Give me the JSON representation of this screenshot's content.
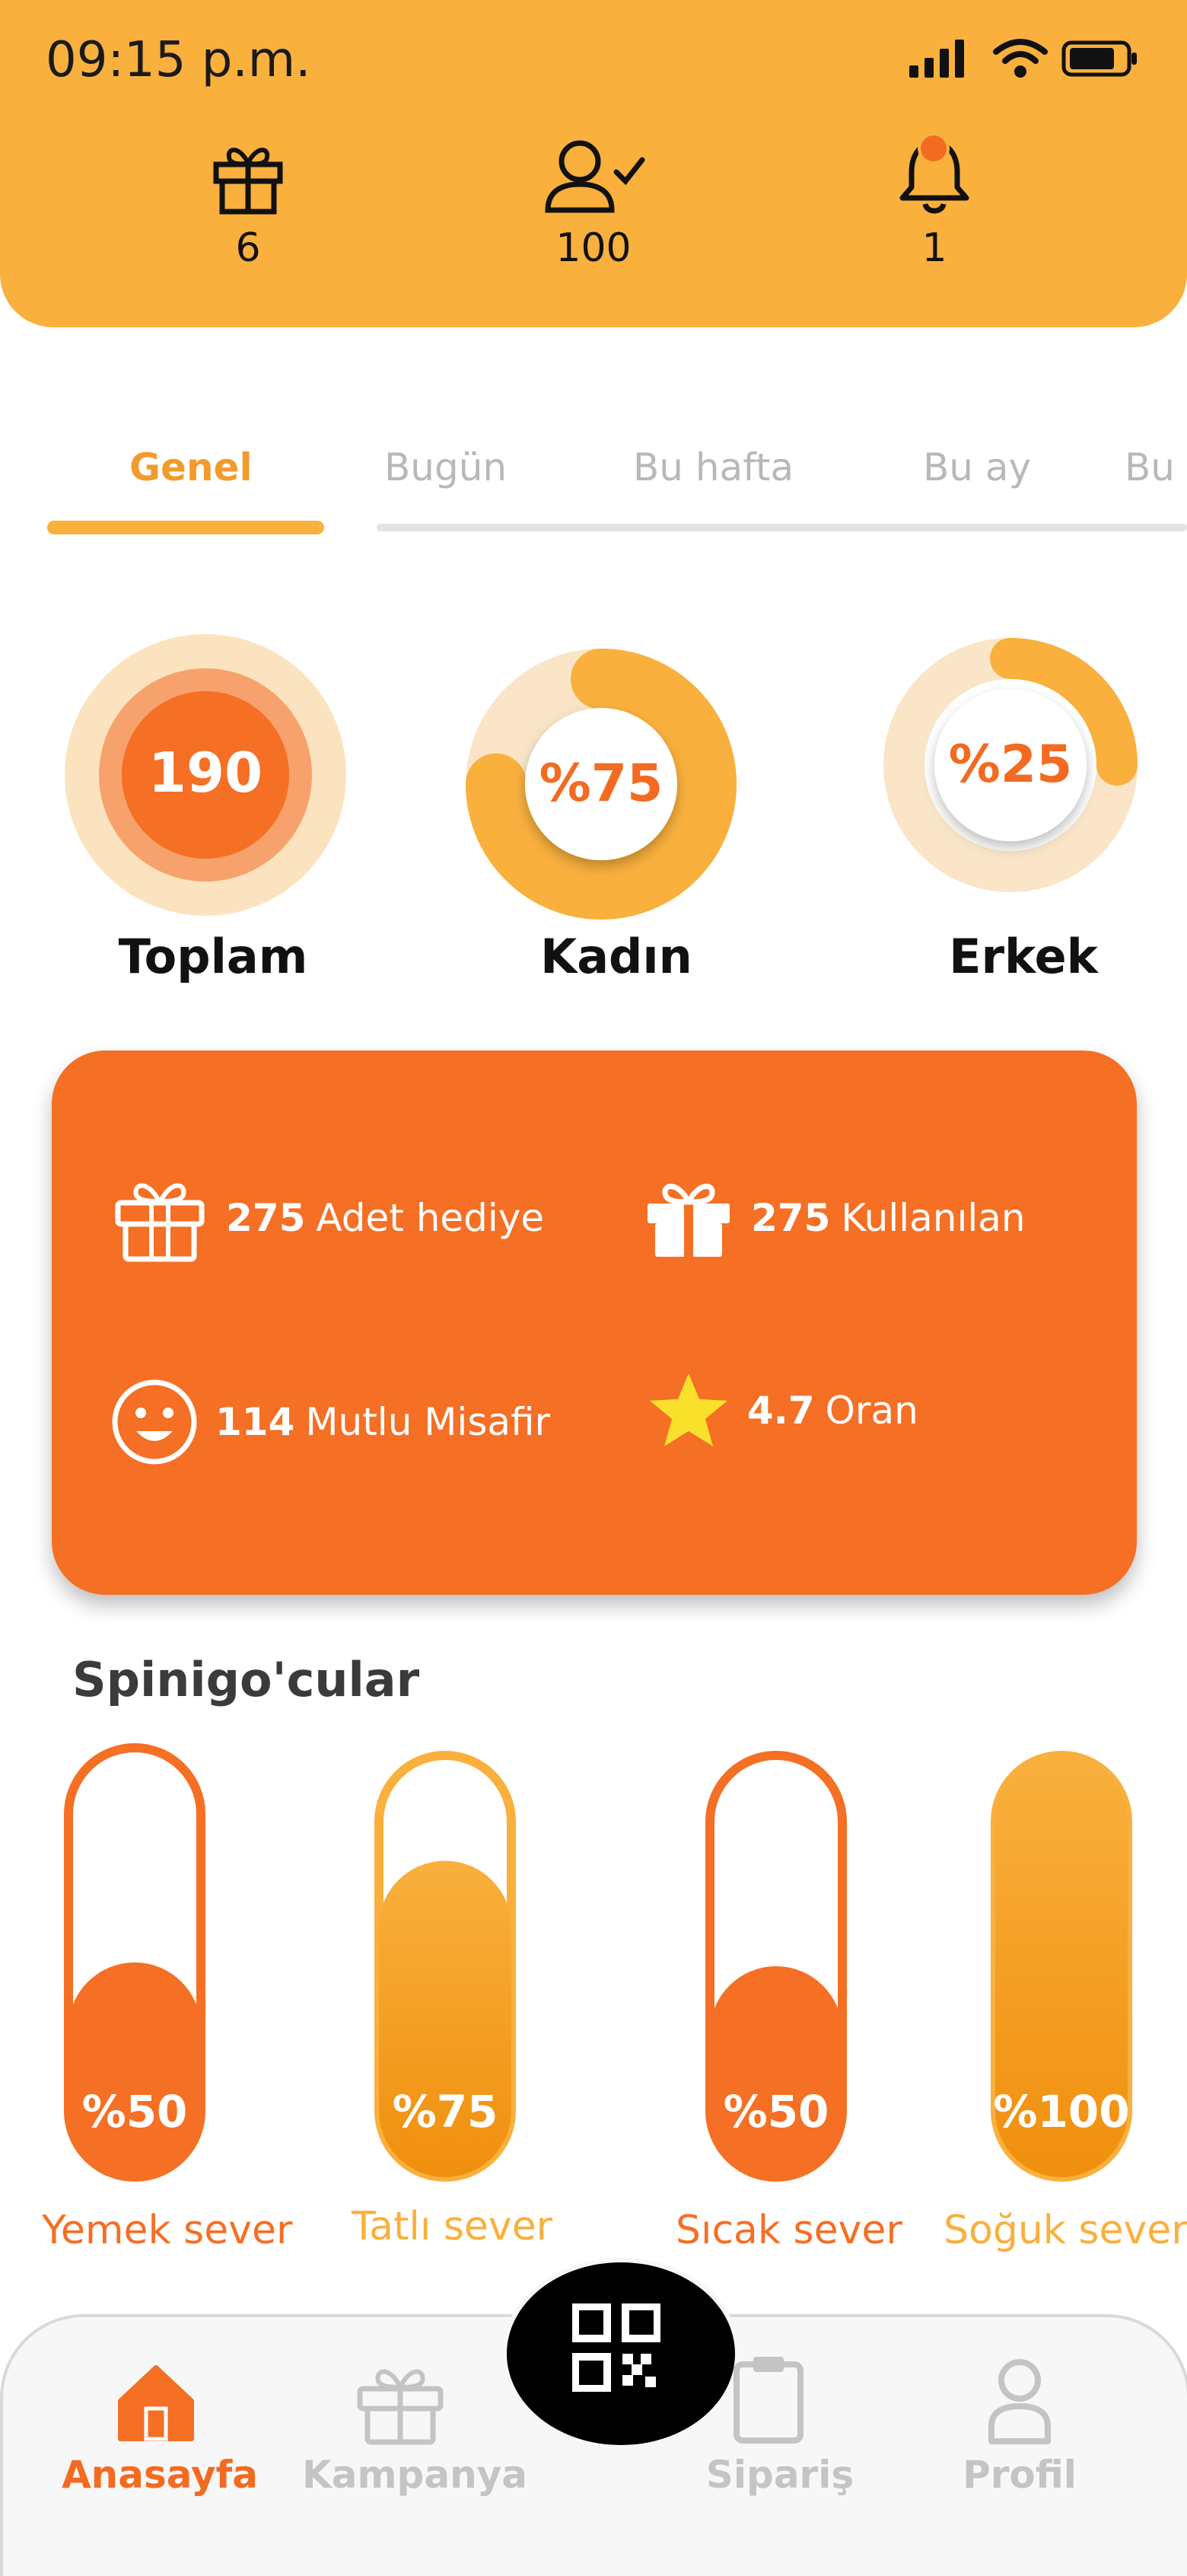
{
  "status_bar": {
    "time": "09:15 p.m."
  },
  "header": {
    "stats": [
      {
        "icon": "gift-icon",
        "value": "6"
      },
      {
        "icon": "user-check-icon",
        "value": "100"
      },
      {
        "icon": "bell-icon",
        "value": "1"
      }
    ]
  },
  "tabs": [
    {
      "label": "Genel",
      "active": true
    },
    {
      "label": "Bugün"
    },
    {
      "label": "Bu hafta"
    },
    {
      "label": "Bu ay"
    },
    {
      "label": "Bu"
    }
  ],
  "summary": {
    "total": {
      "value": "190",
      "label": "Toplam"
    },
    "female": {
      "value": "%75",
      "label": "Kadın",
      "fraction": 0.75
    },
    "male": {
      "value": "%25",
      "label": "Erkek",
      "fraction": 0.25
    }
  },
  "stats_card": {
    "items": [
      {
        "icon": "gift-outline-icon",
        "number": "275",
        "text": "Adet hediye"
      },
      {
        "icon": "gift-icon",
        "number": "275",
        "text": "Kullanılan"
      },
      {
        "icon": "smile-icon",
        "number": "114",
        "text": "Mutlu Misafir"
      },
      {
        "icon": "star-icon",
        "number": "4.7",
        "text": "Oran"
      }
    ]
  },
  "section": {
    "title": "Spinigo'cular"
  },
  "preferences": [
    {
      "value": "%50",
      "label": "Yemek sever",
      "fraction": 0.5
    },
    {
      "value": "%75",
      "label": "Tatlı sever",
      "fraction": 0.75
    },
    {
      "value": "%50",
      "label": "Sıcak sever",
      "fraction": 0.5
    },
    {
      "value": "%100",
      "label": "Soğuk sever",
      "fraction": 1.0
    }
  ],
  "bottom_nav": [
    {
      "label": "Anasayfa",
      "icon": "home-icon",
      "active": true
    },
    {
      "label": "Kampanya",
      "icon": "gift-icon"
    },
    {
      "label": "",
      "icon": "qr-code-icon"
    },
    {
      "label": "Sipariş",
      "icon": "clipboard-icon"
    },
    {
      "label": "Profil",
      "icon": "user-icon"
    }
  ],
  "colors": {
    "header": "#F9B03D",
    "accent": "#F56F24",
    "orange_light": "#F9B03D",
    "inactive": "#c4c4c4"
  }
}
